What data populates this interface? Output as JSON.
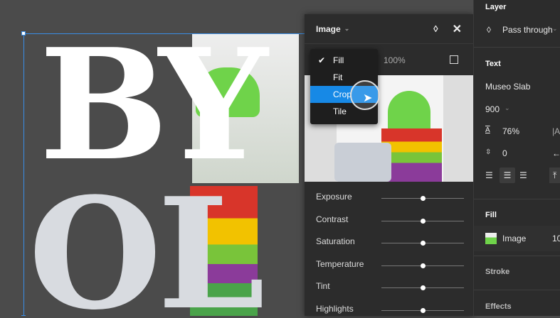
{
  "canvas": {
    "letters_top": "BY",
    "letters_bottom": "OL"
  },
  "image_panel": {
    "title": "Image",
    "scale_value": "100%",
    "fill_mode_menu": {
      "items": [
        {
          "label": "Fill",
          "checked": true
        },
        {
          "label": "Fit",
          "checked": false
        },
        {
          "label": "Crop",
          "checked": false,
          "highlighted": true
        },
        {
          "label": "Tile",
          "checked": false
        }
      ]
    },
    "adjustments": [
      {
        "label": "Exposure",
        "value": 0.5
      },
      {
        "label": "Contrast",
        "value": 0.5
      },
      {
        "label": "Saturation",
        "value": 0.5
      },
      {
        "label": "Temperature",
        "value": 0.5
      },
      {
        "label": "Tint",
        "value": 0.5
      },
      {
        "label": "Highlights",
        "value": 0.5
      }
    ]
  },
  "right_panel": {
    "layer": {
      "title": "Layer",
      "blend_mode": "Pass through"
    },
    "text": {
      "title": "Text",
      "font": "Museo Slab",
      "weight": "900",
      "line_height": "76%",
      "paragraph_spacing": "0"
    },
    "fill": {
      "title": "Fill",
      "type": "Image",
      "opacity": "10"
    },
    "stroke": {
      "title": "Stroke"
    },
    "effects": {
      "title": "Effects"
    }
  },
  "colors": {
    "accent": "#1789e6",
    "panel": "#2c2c2c",
    "canvas": "#4b4b4b"
  }
}
